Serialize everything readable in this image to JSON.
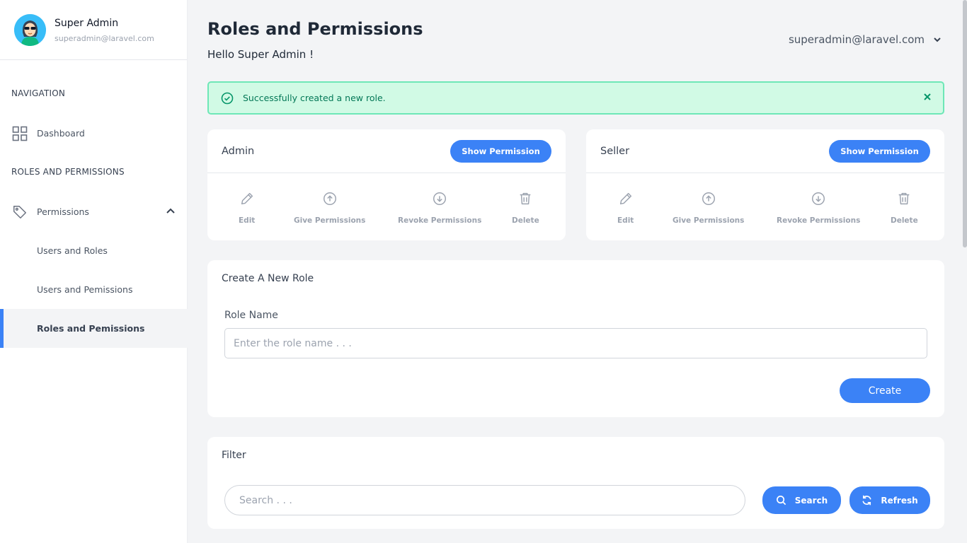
{
  "profile": {
    "name": "Super Admin",
    "email": "superadmin@laravel.com"
  },
  "nav": {
    "heading_navigation": "NAVIGATION",
    "dashboard": "Dashboard",
    "heading_roles": "ROLES AND PERMISSIONS",
    "permissions": "Permissions",
    "users_roles": "Users and Roles",
    "users_permissions": "Users and Pemissions",
    "roles_permissions": "Roles and Pemissions"
  },
  "header": {
    "title": "Roles and Permissions",
    "greeting": "Hello Super Admin !",
    "user_email": "superadmin@laravel.com"
  },
  "alert": {
    "message": "Successfully created a new role."
  },
  "roles": [
    {
      "name": "Admin",
      "show_label": "Show Permission",
      "edit": "Edit",
      "give": "Give Permissions",
      "revoke": "Revoke Permissions",
      "delete": "Delete"
    },
    {
      "name": "Seller",
      "show_label": "Show Permission",
      "edit": "Edit",
      "give": "Give Permissions",
      "revoke": "Revoke Permissions",
      "delete": "Delete"
    }
  ],
  "create": {
    "title": "Create A New Role",
    "label": "Role Name",
    "placeholder": "Enter the role name . . .",
    "button": "Create"
  },
  "filter": {
    "title": "Filter",
    "placeholder": "Search . . .",
    "search_button": "Search",
    "refresh_button": "Refresh"
  },
  "colors": {
    "accent": "#3b82f6",
    "success_bg": "#d1fae5",
    "success_text": "#047857"
  },
  "icons": {
    "dashboard": "grid-icon",
    "permissions": "tag-icon",
    "alert": "check-circle-icon",
    "close": "close-icon",
    "edit": "pencil-icon",
    "give": "arrow-up-circle-icon",
    "revoke": "arrow-down-circle-icon",
    "delete": "trash-icon",
    "search": "search-icon",
    "refresh": "refresh-icon"
  }
}
